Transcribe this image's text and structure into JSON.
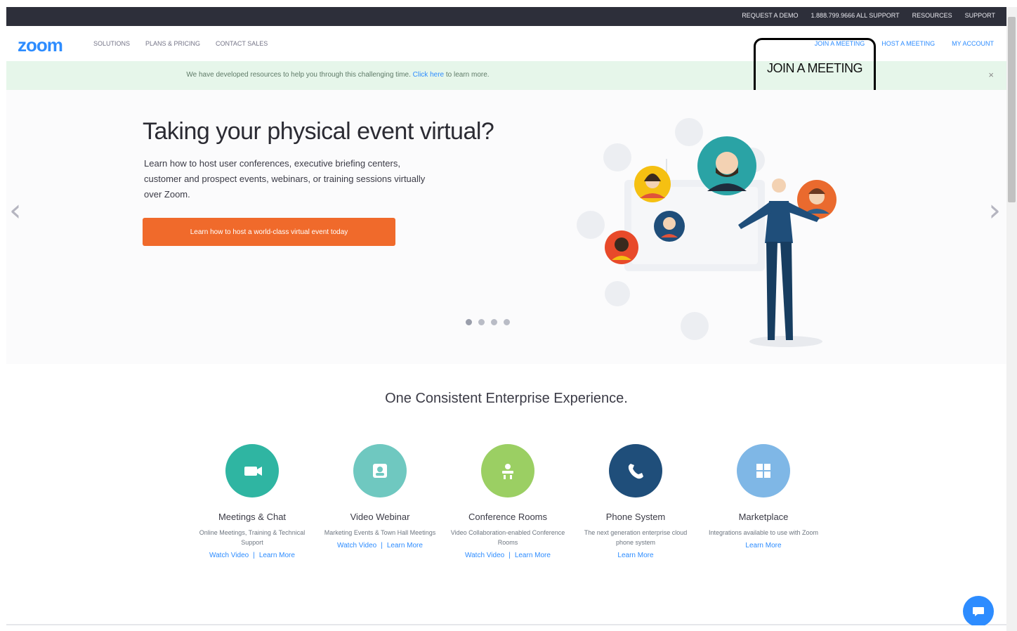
{
  "topbar": {
    "links": [
      "REQUEST A DEMO",
      "1.888.799.9666 ALL SUPPORT",
      "RESOURCES",
      "SUPPORT"
    ]
  },
  "nav": {
    "logo": "zoom",
    "left": [
      "SOLUTIONS",
      "PLANS & PRICING",
      "CONTACT SALES"
    ],
    "right": [
      "JOIN A MEETING",
      "HOST A MEETING",
      "MY ACCOUNT"
    ]
  },
  "banner": {
    "text_before": "We have developed resources to help you through this challenging time.",
    "link": "Click here",
    "text_after": "to learn more.",
    "close": "×"
  },
  "callout": {
    "label": "JOIN A MEETING"
  },
  "hero": {
    "title": "Taking your physical event virtual?",
    "body": "Learn how to host user conferences, executive briefing centers, customer and prospect events, webinars, or training sessions virtually over Zoom.",
    "cta": "Learn how to host a world-class virtual event today",
    "prev": "‹",
    "next": "›",
    "slides": 4,
    "active_slide": 1
  },
  "section": {
    "title": "One Consistent Enterprise Experience."
  },
  "products": [
    {
      "name": "Meetings & Chat",
      "desc": "Online Meetings, Training & Technical Support",
      "links": [
        "Watch Video",
        "Learn More"
      ],
      "color": "#2fb5a2",
      "icon": "video-camera-icon"
    },
    {
      "name": "Video Webinar",
      "desc": "Marketing Events & Town Hall Meetings",
      "links": [
        "Watch Video",
        "Learn More"
      ],
      "color": "#6fc8c0",
      "icon": "presenter-icon"
    },
    {
      "name": "Conference Rooms",
      "desc": "Video Collaboration-enabled Conference Rooms",
      "links": [
        "Watch Video",
        "Learn More"
      ],
      "color": "#9bcf63",
      "icon": "conference-room-icon"
    },
    {
      "name": "Phone System",
      "desc": "The next generation enterprise cloud phone system",
      "links": [
        "Learn More"
      ],
      "color": "#1f4e7a",
      "icon": "phone-icon"
    },
    {
      "name": "Marketplace",
      "desc": "Integrations available to use with Zoom",
      "links": [
        "Learn More"
      ],
      "color": "#7fb7e6",
      "icon": "grid-icon"
    }
  ],
  "colors": {
    "brand": "#2d8cff",
    "cta": "#f06a2b",
    "topbar": "#2d2f3a",
    "banner": "#e6f6ea"
  }
}
